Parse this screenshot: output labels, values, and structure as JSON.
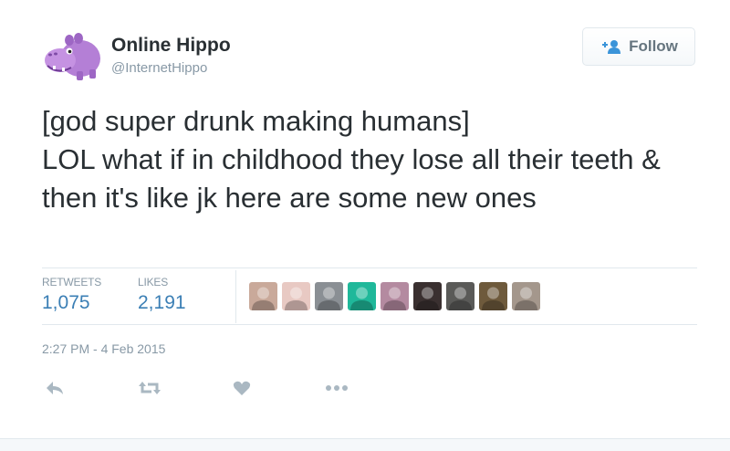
{
  "user": {
    "display_name": "Online Hippo",
    "screen_name": "@InternetHippo",
    "avatar_icon": "purple-hippo-avatar"
  },
  "follow_button": {
    "label": "Follow",
    "icon": "follow-person-plus-icon"
  },
  "tweet": {
    "text": "[god super drunk making humans]\nLOL what if in childhood they lose all their teeth & then it's like jk here are some new ones",
    "timestamp": "2:27 PM - 4 Feb 2015"
  },
  "stats": {
    "retweets_label": "RETWEETS",
    "retweets_count": "1,075",
    "likes_label": "LIKES",
    "likes_count": "2,191"
  },
  "liker_avatars": [
    {
      "name": "liker-1",
      "color": "#c9a99a"
    },
    {
      "name": "liker-2",
      "color": "#e8c9c3"
    },
    {
      "name": "liker-3",
      "color": "#8a8f94"
    },
    {
      "name": "liker-4",
      "color": "#1fb89a"
    },
    {
      "name": "liker-5",
      "color": "#b48aa0"
    },
    {
      "name": "liker-6",
      "color": "#3a3030"
    },
    {
      "name": "liker-7",
      "color": "#5a5a58"
    },
    {
      "name": "liker-8",
      "color": "#6e5a3c"
    },
    {
      "name": "liker-9",
      "color": "#a4978c"
    }
  ],
  "actions": [
    "reply-icon",
    "retweet-icon",
    "like-icon",
    "more-icon"
  ],
  "colors": {
    "link_blue": "#3b7fb5",
    "muted_gray": "#8899a6",
    "text_dark": "#292f33",
    "hippo_purple": "#b47fd6"
  }
}
